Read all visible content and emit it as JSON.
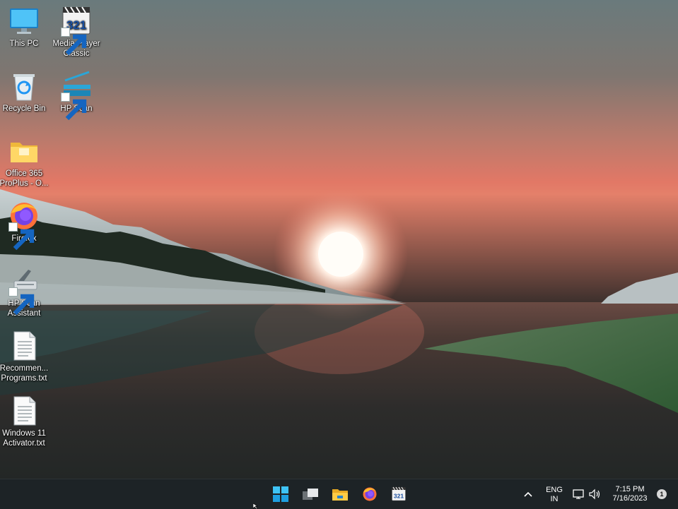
{
  "desktop": {
    "icons": [
      {
        "label": "This PC",
        "icon": "monitor-icon",
        "shortcut": false
      },
      {
        "label": "Media Player Classic",
        "icon": "media-player-classic-icon",
        "shortcut": true
      },
      {
        "label": "Recycle Bin",
        "icon": "recycle-bin-icon",
        "shortcut": false
      },
      {
        "label": "HP Scan",
        "icon": "scanner-icon",
        "shortcut": true
      },
      {
        "label": "Office 365 ProPlus - O...",
        "icon": "folder-icon",
        "shortcut": false
      },
      {
        "label": "Firefox",
        "icon": "firefox-icon",
        "shortcut": true
      },
      {
        "label": "HP Scan Assistant",
        "icon": "printer-scanner-icon",
        "shortcut": true
      },
      {
        "label": "Recommen... Programs.txt",
        "icon": "text-file-icon",
        "shortcut": false
      },
      {
        "label": "Windows 11 Activator.txt",
        "icon": "text-file-icon",
        "shortcut": false
      }
    ]
  },
  "taskbar": {
    "apps": [
      {
        "name": "Start",
        "icon": "windows-start-icon"
      },
      {
        "name": "Task View",
        "icon": "task-view-icon"
      },
      {
        "name": "File Explorer",
        "icon": "file-explorer-icon"
      },
      {
        "name": "Firefox",
        "icon": "firefox-icon"
      },
      {
        "name": "Media Player Classic",
        "icon": "media-player-classic-icon"
      }
    ],
    "tray": {
      "language_line1": "ENG",
      "language_line2": "IN",
      "time": "7:15 PM",
      "date": "7/16/2023",
      "notification_count": "1"
    }
  },
  "colors": {
    "taskbar_bg": "#1d2326",
    "sky_top": "#6c7b7e",
    "sky_horizon": "#e37866",
    "water": "#2a2c2c"
  }
}
